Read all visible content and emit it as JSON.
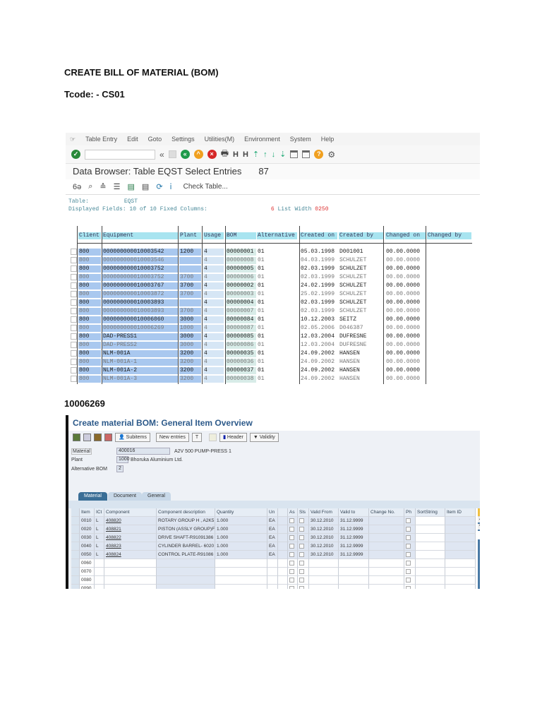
{
  "doc": {
    "heading": "CREATE BILL OF MATERIAL (BOM)",
    "tcode": "Tcode: -  CS01",
    "section_label": "10006269"
  },
  "s1": {
    "menu": [
      "Table Entry",
      "Edit",
      "Goto",
      "Settings",
      "Utilities(M)",
      "Environment",
      "System",
      "Help"
    ],
    "title": "Data Browser: Table EQST Select Entries",
    "count": "87",
    "check_table": "Check Table...",
    "info_table_label": "Table:",
    "info_table": "EQST",
    "info_fields": "Displayed Fields:  10 of  10  Fixed Columns:",
    "info_fixed": "6",
    "info_width_label": "List Width",
    "info_width": "0250",
    "columns": [
      "Client",
      "Equipment",
      "Plant",
      "Usage",
      "BOM",
      "Alternative",
      "Created on",
      "Created by",
      "Changed on",
      "Changed by"
    ],
    "rows": [
      [
        "800",
        "000000000010003542",
        "1200",
        "4",
        "00000001",
        "01",
        "05.03.1998",
        "D001001",
        "00.00.0000",
        ""
      ],
      [
        "800",
        "000000000010003546",
        "",
        "4",
        "00000008",
        "01",
        "04.03.1999",
        "SCHULZET",
        "00.00.0000",
        ""
      ],
      [
        "800",
        "000000000010003752",
        "",
        "4",
        "00000005",
        "01",
        "02.03.1999",
        "SCHULZET",
        "00.00.0000",
        ""
      ],
      [
        "800",
        "000000000010003752",
        "3700",
        "4",
        "00000006",
        "01",
        "02.03.1999",
        "SCHULZET",
        "00.00.0000",
        ""
      ],
      [
        "800",
        "000000000010003767",
        "3700",
        "4",
        "00000002",
        "01",
        "24.02.1999",
        "SCHULZET",
        "00.00.0000",
        ""
      ],
      [
        "800",
        "000000000010003872",
        "3700",
        "4",
        "00000003",
        "01",
        "25.02.1999",
        "SCHULZET",
        "00.00.0000",
        ""
      ],
      [
        "800",
        "000000000010003893",
        "",
        "4",
        "00000004",
        "01",
        "02.03.1999",
        "SCHULZET",
        "00.00.0000",
        ""
      ],
      [
        "800",
        "000000000010003893",
        "3700",
        "4",
        "00000007",
        "01",
        "02.03.1999",
        "SCHULZET",
        "00.00.0000",
        ""
      ],
      [
        "800",
        "000000000010006060",
        "3000",
        "4",
        "00000084",
        "01",
        "10.12.2003",
        "SEITZ",
        "00.00.0000",
        ""
      ],
      [
        "800",
        "000000000010006269",
        "1000",
        "4",
        "00000087",
        "01",
        "02.05.2006",
        "D046387",
        "00.00.0000",
        ""
      ],
      [
        "800",
        "DAD-PRESS1",
        "3000",
        "4",
        "00000085",
        "01",
        "12.03.2004",
        "DUFRESNE",
        "00.00.0000",
        ""
      ],
      [
        "800",
        "DAD-PRESS2",
        "3000",
        "4",
        "00000086",
        "01",
        "12.03.2004",
        "DUFRESNE",
        "00.00.0000",
        ""
      ],
      [
        "800",
        "NLM-001A",
        "3200",
        "4",
        "00000035",
        "01",
        "24.09.2002",
        "HANSEN",
        "00.00.0000",
        ""
      ],
      [
        "800",
        "NLM-001A-1",
        "3200",
        "4",
        "00000036",
        "01",
        "24.09.2002",
        "HANSEN",
        "00.00.0000",
        ""
      ],
      [
        "800",
        "NLM-001A-2",
        "3200",
        "4",
        "00000037",
        "01",
        "24.09.2002",
        "HANSEN",
        "00.00.0000",
        ""
      ],
      [
        "800",
        "NLM-001A-3",
        "3200",
        "4",
        "00000038",
        "01",
        "24.09.2002",
        "HANSEN",
        "00.00.0000",
        ""
      ]
    ]
  },
  "s2": {
    "title": "Create material BOM: General Item Overview",
    "buttons": {
      "subitems": "Subitems",
      "new_entries": "New entries",
      "header": "Header",
      "validity": "Validity"
    },
    "material_label": "Material",
    "material": "400016",
    "material_desc": "A2V 500 PUMP-PRESS 1",
    "plant_label": "Plant",
    "plant": "1000",
    "plant_desc": "Bhoruka Aluminium Ltd.",
    "alt_label": "Alternative BOM",
    "alt": "2",
    "tabs": [
      "Material",
      "Document",
      "General"
    ],
    "columns": [
      "Item",
      "ICt",
      "Component",
      "Component description",
      "Quantity",
      "Un",
      "",
      "As",
      "Sls",
      "Valid From",
      "Valid to",
      "Change No.",
      "Ph",
      "SortString",
      "Item ID"
    ],
    "rows": [
      [
        "0010",
        "L",
        "408820",
        "ROTARY GROUP H , A2K5",
        "1.000",
        "EA",
        "",
        "",
        "",
        "30.12.2010",
        "31.12.9999",
        "",
        "",
        "",
        ""
      ],
      [
        "0020",
        "L",
        "408821",
        "PISTON (ASSLY GROUP)F",
        "1.000",
        "EA",
        "",
        "",
        "",
        "30.12.2010",
        "31.12.9999",
        "",
        "",
        "",
        ""
      ],
      [
        "0030",
        "L",
        "408822",
        "DRIVE SHAFT-R91091386",
        "1.000",
        "EA",
        "",
        "",
        "",
        "30.12.2010",
        "31.12.9999",
        "",
        "",
        "",
        ""
      ],
      [
        "0040",
        "L",
        "408823",
        "CYLINDER BARREL- 6020",
        "1.000",
        "EA",
        "",
        "",
        "",
        "30.12.2010",
        "31.12.9999",
        "",
        "",
        "",
        ""
      ],
      [
        "0050",
        "L",
        "408824",
        "CONTROL PLATE-R91086",
        "1.000",
        "EA",
        "",
        "",
        "",
        "30.12.2010",
        "31.12.9999",
        "",
        "",
        "",
        ""
      ],
      [
        "0060",
        "",
        "",
        "",
        "",
        "",
        "",
        "",
        "",
        "",
        "",
        "",
        "",
        "",
        ""
      ],
      [
        "0070",
        "",
        "",
        "",
        "",
        "",
        "",
        "",
        "",
        "",
        "",
        "",
        "",
        "",
        ""
      ],
      [
        "0080",
        "",
        "",
        "",
        "",
        "",
        "",
        "",
        "",
        "",
        "",
        "",
        "",
        "",
        ""
      ],
      [
        "0090",
        "",
        "",
        "",
        "",
        "",
        "",
        "",
        "",
        "",
        "",
        "",
        "",
        "",
        ""
      ]
    ]
  }
}
